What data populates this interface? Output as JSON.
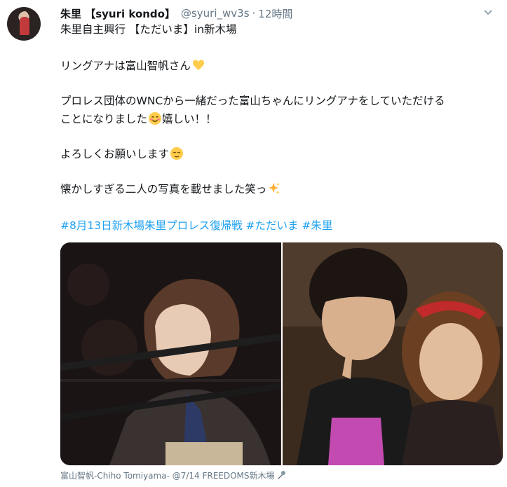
{
  "user": {
    "display_name": "朱里 【syuri kondo】",
    "handle": "@syuri_wv3s",
    "separator": "·",
    "time": "12時間"
  },
  "tweet": {
    "lines": [
      "朱里自主興行 【ただいま】in新木場",
      "リングアナは富山智帆さん",
      "プロレス団体のWNCから一緒だった富山ちゃんにリングアナをしていただける",
      "ことになりました",
      "嬉しい！！",
      "よろしくお願いします",
      "懐かしすぎる二人の写真を載せました笑っ"
    ],
    "hashtags": "#8月13日新木場朱里プロレス復帰戦 #ただいま #朱里"
  },
  "media": {
    "left_photo": "photo-left",
    "right_photo": "photo-right"
  },
  "caption": "富山智帆-Chiho Tomiyama- @7/14 FREEDOMS新木場",
  "icons": {
    "heart": "yellow-heart-icon",
    "smile": "smiling-face-icon",
    "relieved": "relieved-face-icon",
    "sparkles": "sparkles-icon",
    "microphone": "microphone-icon",
    "caret": "chevron-down-icon"
  },
  "colors": {
    "link": "#1da1f2",
    "secondary": "#657786",
    "text": "#14171a"
  }
}
